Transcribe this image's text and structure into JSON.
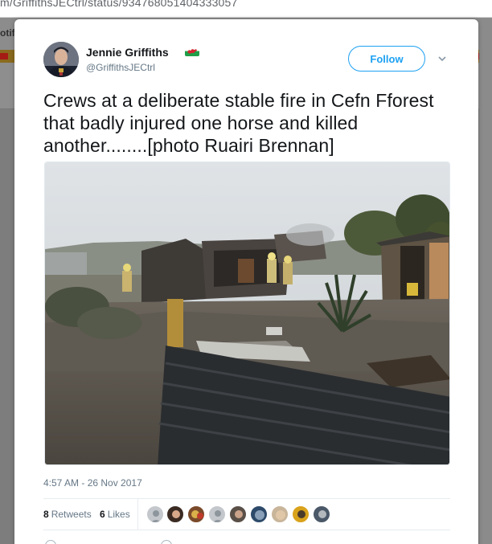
{
  "browser": {
    "url": "m/GriffithsJECtrl/status/934768051404333057"
  },
  "background_page": {
    "left_text": "otif",
    "right_text": "r"
  },
  "tweet": {
    "author_name": "Jennie Griffiths",
    "author_handle": "@GriffithsJECtrl",
    "name_emoji": "welsh-flag",
    "follow_label": "Follow",
    "text": "Crews at a deliberate stable fire in Cefn Fforest that badly injured one horse and killed another........[photo Ruairi Brennan]",
    "timestamp": "4:57 AM - 26 Nov 2017",
    "retweets_count": "8",
    "retweets_label": "Retweets",
    "likes_count": "6",
    "likes_label": "Likes",
    "liker_count_shown": 9
  },
  "icons": {
    "caret": "chevron-down-icon",
    "verified_flag": "welsh-flag-icon"
  },
  "colors": {
    "accent": "#1da1f2",
    "text_primary": "#14171a",
    "text_secondary": "#657786",
    "overlay": "#7d7d7d"
  }
}
